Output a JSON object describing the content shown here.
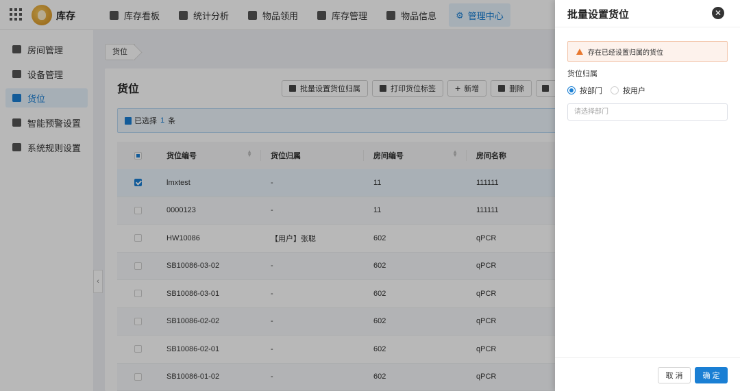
{
  "app": {
    "name": "库存"
  },
  "nav": [
    {
      "label": "库存看板",
      "icon": "dashboard-icon"
    },
    {
      "label": "统计分析",
      "icon": "chart-icon"
    },
    {
      "label": "物品领用",
      "icon": "handout-icon"
    },
    {
      "label": "库存管理",
      "icon": "inventory-icon"
    },
    {
      "label": "物品信息",
      "icon": "item-info-icon"
    },
    {
      "label": "管理中心",
      "icon": "gear-icon",
      "active": true
    }
  ],
  "sidebar": [
    {
      "label": "房间管理",
      "icon": "room-icon"
    },
    {
      "label": "设备管理",
      "icon": "device-icon"
    },
    {
      "label": "货位",
      "icon": "shelf-icon",
      "active": true
    },
    {
      "label": "智能预警设置",
      "icon": "alert-icon"
    },
    {
      "label": "系统规则设置",
      "icon": "rules-icon"
    }
  ],
  "breadcrumb": "货位",
  "main": {
    "title": "货位",
    "toolbar": [
      {
        "label": "批量设置货位归属",
        "icon": "batch-icon"
      },
      {
        "label": "打印货位标签",
        "icon": "print-icon"
      },
      {
        "label": "新增",
        "icon": "plus-icon"
      },
      {
        "label": "删除",
        "icon": "trash-icon"
      }
    ],
    "selected": {
      "prefix": "已选择",
      "count": "1",
      "suffix": "条"
    },
    "columns": [
      "货位编号",
      "货位归属",
      "房间编号",
      "房间名称"
    ],
    "rows": [
      {
        "code": "lmxtest",
        "owner": "-",
        "room_no": "11",
        "room_name": "111111",
        "checked": true
      },
      {
        "code": "0000123",
        "owner": "-",
        "room_no": "11",
        "room_name": "111111"
      },
      {
        "code": "HW10086",
        "owner": "【用户】张聪",
        "room_no": "602",
        "room_name": "qPCR"
      },
      {
        "code": "SB10086-03-02",
        "owner": "-",
        "room_no": "602",
        "room_name": "qPCR"
      },
      {
        "code": "SB10086-03-01",
        "owner": "-",
        "room_no": "602",
        "room_name": "qPCR"
      },
      {
        "code": "SB10086-02-02",
        "owner": "-",
        "room_no": "602",
        "room_name": "qPCR"
      },
      {
        "code": "SB10086-02-01",
        "owner": "-",
        "room_no": "602",
        "room_name": "qPCR"
      },
      {
        "code": "SB10086-01-02",
        "owner": "-",
        "room_no": "602",
        "room_name": "qPCR"
      }
    ]
  },
  "drawer": {
    "title": "批量设置货位",
    "warning": "存在已经设置归属的货位",
    "field_label": "货位归属",
    "options": [
      "按部门",
      "按用户"
    ],
    "selected_option": 0,
    "dept_placeholder": "请选择部门",
    "dept_value": "",
    "cancel": "取 消",
    "confirm": "确 定"
  }
}
